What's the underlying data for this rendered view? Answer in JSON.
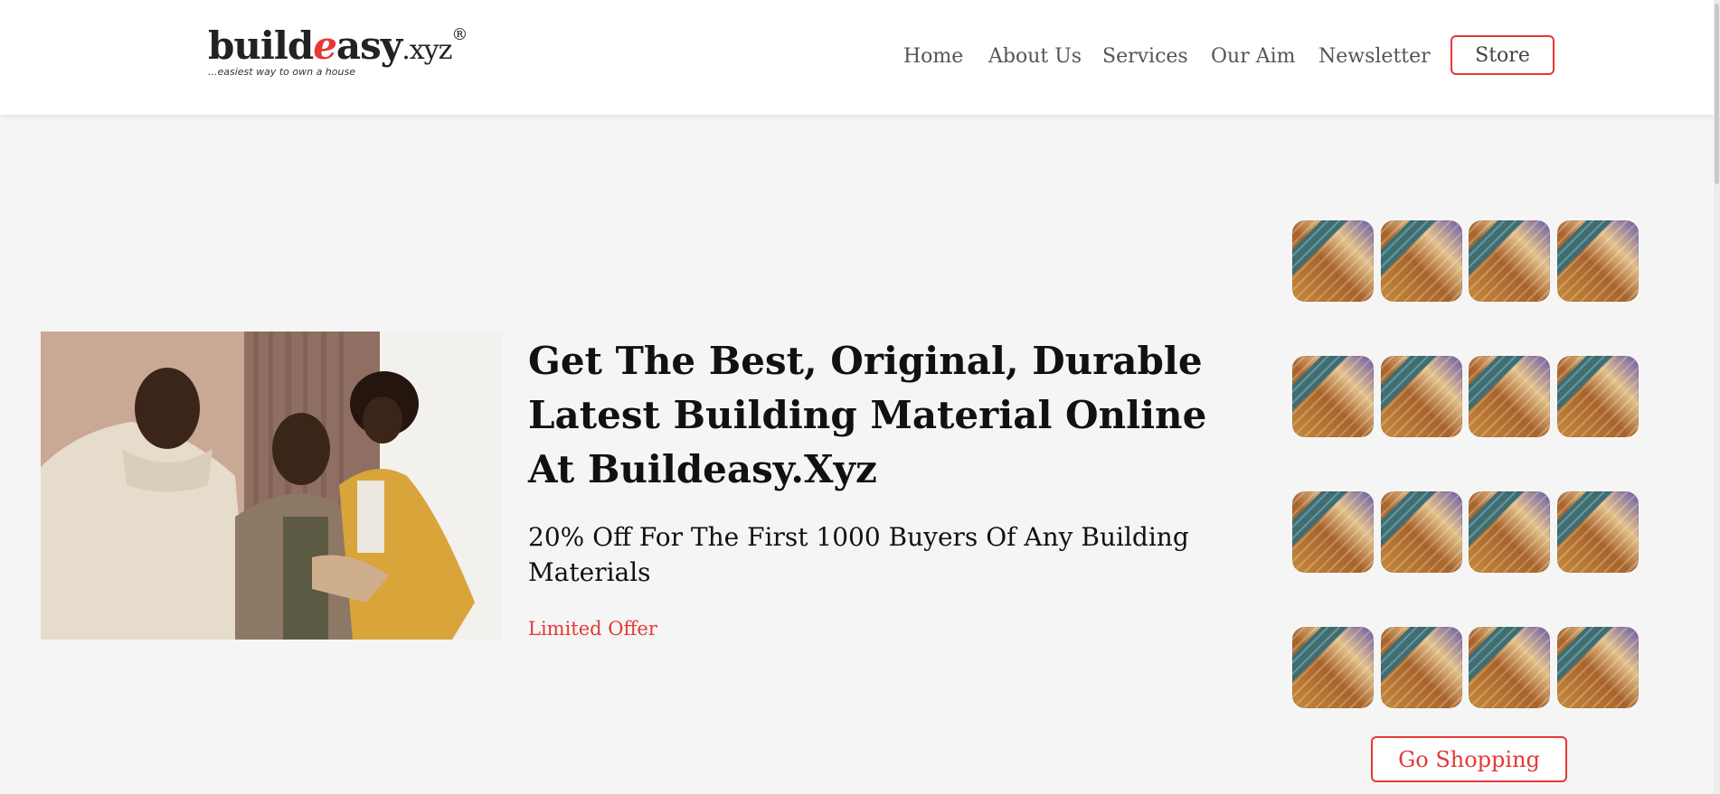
{
  "header": {
    "logo": {
      "word_pre": "build",
      "word_e": "e",
      "word_post": "asy",
      "domain": ".xyz",
      "registered": "®",
      "tagline": "...easiest way to own a house"
    },
    "nav": [
      "Home",
      "About Us",
      "Services",
      "Our Aim",
      "Newsletter"
    ],
    "store_label": "Store"
  },
  "hero": {
    "image_alt": "three people smiling",
    "headline": "Get The Best, Original, Durable Latest Building Material Online At Buildeasy.Xyz",
    "subheadline": "20% Off For The First 1000 Buyers Of Any Building Materials",
    "offer_label": "Limited Offer"
  },
  "product_grid": {
    "rows": 4,
    "columns": 4
  },
  "shop_button_label": "Go Shopping",
  "colors": {
    "accent": "#e53935",
    "background": "#f5f5f5",
    "header_bg": "#ffffff"
  }
}
